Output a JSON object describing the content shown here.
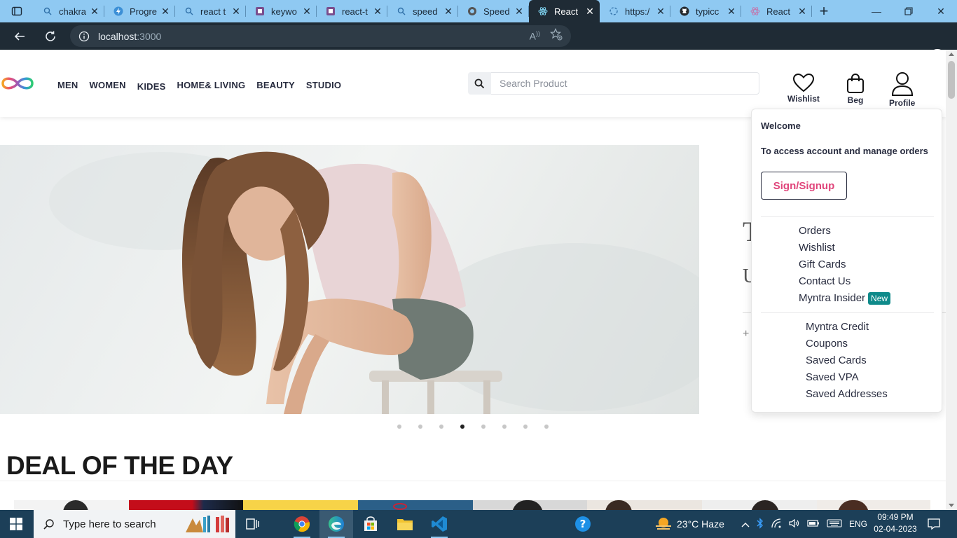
{
  "browser": {
    "tabs": [
      {
        "title": "chakra",
        "icon": "search-icon"
      },
      {
        "title": "Progre",
        "icon": "lightning-icon"
      },
      {
        "title": "react t",
        "icon": "search-icon"
      },
      {
        "title": "keywo",
        "icon": "tab-square-icon"
      },
      {
        "title": "react-t",
        "icon": "tab-square-icon"
      },
      {
        "title": "speed",
        "icon": "search-icon"
      },
      {
        "title": "Speed",
        "icon": "circle-icon"
      },
      {
        "title": "React",
        "icon": "react-icon",
        "active": true
      },
      {
        "title": "https:/",
        "icon": "loading-icon"
      },
      {
        "title": "typicc",
        "icon": "github-icon"
      },
      {
        "title": "React",
        "icon": "react-icon"
      }
    ],
    "url_host": "localhost",
    "url_port": ":3000"
  },
  "site": {
    "menu": [
      "MEN",
      "WOMEN",
      "KIDES",
      "HOME& LIVING",
      "BEAUTY",
      "STUDIO"
    ],
    "search_placeholder": "Search Product",
    "header_icons": {
      "wishlist": "Wishlist",
      "bag": "Beg",
      "profile": "Profile"
    },
    "carousel": {
      "slide_count": 8,
      "active_index": 3,
      "side_text_1": "T",
      "side_text_2": "U",
      "side_plus": "+"
    },
    "deal_title": "DEAL OF THE DAY"
  },
  "profile_dropdown": {
    "welcome": "Welcome",
    "subtitle": "To access account and manage orders",
    "sign_button": "Sign/Signup",
    "group1": [
      "Orders",
      "Wishlist",
      "Gift Cards",
      "Contact Us",
      "Myntra Insider"
    ],
    "new_badge": "New",
    "group2": [
      "Myntra Credit",
      "Coupons",
      "Saved Cards",
      "Saved VPA",
      "Saved Addresses"
    ]
  },
  "taskbar": {
    "search_text": "Type here to search",
    "weather": "23°C  Haze",
    "language": "ENG",
    "time": "09:49 PM",
    "date": "02-04-2023"
  },
  "colors": {
    "accent_pink": "#e0457b",
    "badge_teal": "#0f8a8a",
    "tab_bar": "#8fc9f2",
    "taskbar": "#1c3f58"
  }
}
